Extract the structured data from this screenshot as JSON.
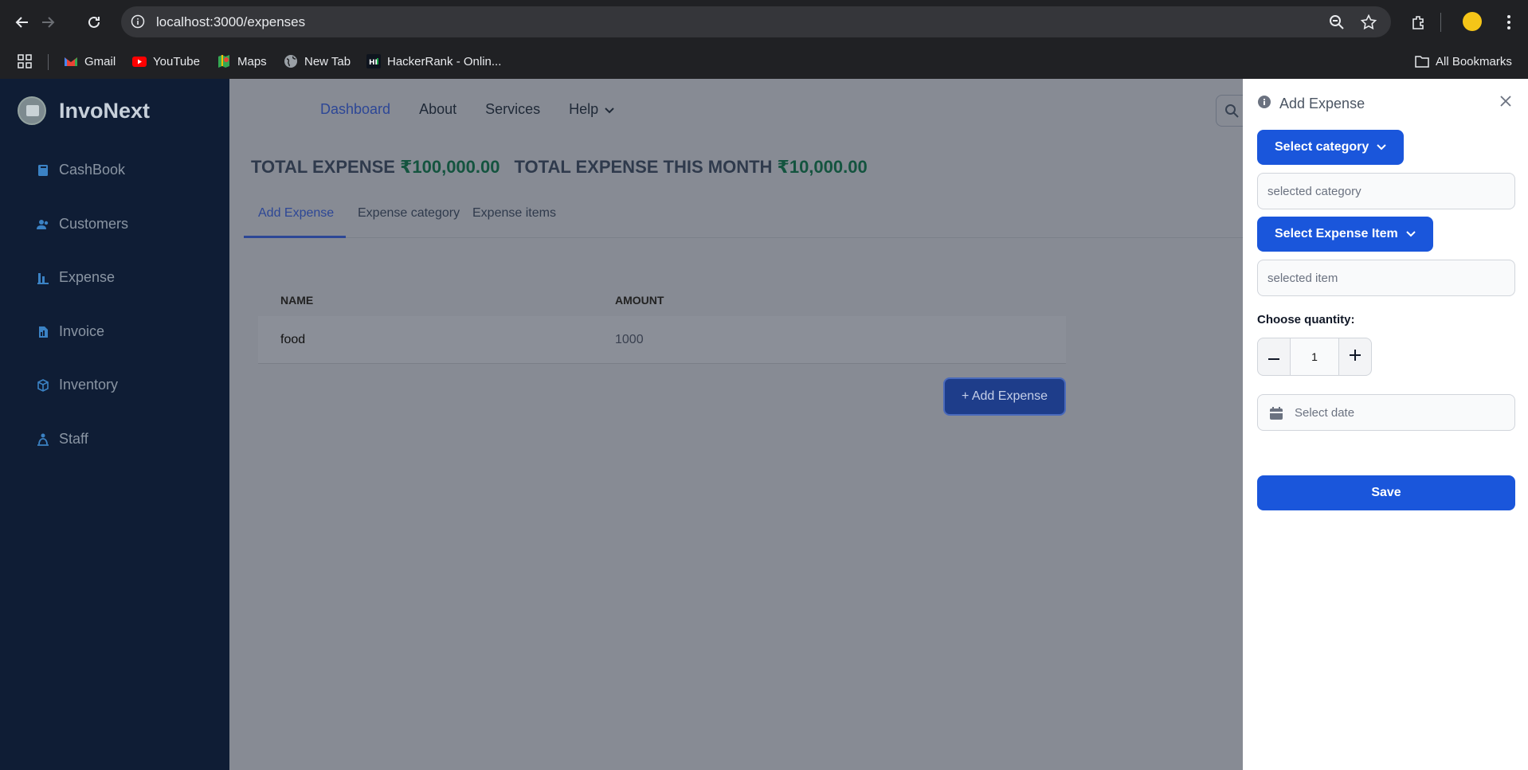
{
  "browser": {
    "url": "localhost:3000/expenses",
    "bookmarks": [
      "Gmail",
      "YouTube",
      "Maps",
      "New Tab",
      "HackerRank - Onlin..."
    ],
    "all_bookmarks": "All Bookmarks"
  },
  "sidebar": {
    "brand": "InvoNext",
    "items": [
      {
        "label": "CashBook",
        "icon": "book-icon"
      },
      {
        "label": "Customers",
        "icon": "users-icon"
      },
      {
        "label": "Expense",
        "icon": "chart-bar-icon"
      },
      {
        "label": "Invoice",
        "icon": "file-invoice-icon"
      },
      {
        "label": "Inventory",
        "icon": "cube-icon"
      },
      {
        "label": "Staff",
        "icon": "person-icon"
      }
    ]
  },
  "topnav": {
    "dashboard": "Dashboard",
    "about": "About",
    "services": "Services",
    "help": "Help"
  },
  "totals": {
    "total_label": "TOTAL EXPENSE",
    "total_value": "₹100,000.00",
    "month_label": "TOTAL EXPENSE THIS MONTH",
    "month_value": "₹10,000.00"
  },
  "tabs": [
    "Add Expense",
    "Expense category",
    "Expense items"
  ],
  "table": {
    "headers": [
      "NAME",
      "AMOUNT"
    ],
    "rows": [
      {
        "name": "food",
        "amount": "1000"
      }
    ]
  },
  "add_button": "+ Add Expense",
  "drawer": {
    "title": "Add Expense",
    "select_category": "Select category",
    "category_placeholder": "selected category",
    "select_item": "Select Expense Item",
    "item_placeholder": "selected item",
    "quantity_label": "Choose quantity:",
    "quantity": "1",
    "date_placeholder": "Select date",
    "save": "Save"
  },
  "colors": {
    "primary": "#1a56db",
    "sidebar_bg": "#0f1d35",
    "overlay": "#878b94",
    "amount_green": "#14543f"
  }
}
